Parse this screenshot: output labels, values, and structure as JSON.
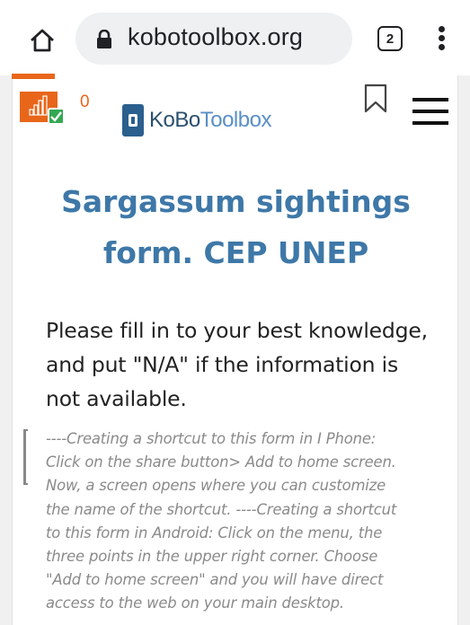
{
  "browser": {
    "url": "kobotoolbox.org",
    "tab_count": "2",
    "icons": [
      "home-icon",
      "lock-icon",
      "tab-switcher-icon",
      "more-vert-icon"
    ]
  },
  "header": {
    "queue_count": "0",
    "logo": {
      "kobo": "KoBo",
      "toolbox": "Toolbox"
    },
    "icons": [
      "offline-status-icon",
      "bookmark-icon",
      "hamburger-menu-icon"
    ]
  },
  "form": {
    "title_line1": "Sargassum sightings",
    "title_line2": "form. CEP UNEP",
    "intro_line1": "Please fill in to your best knowledge,",
    "intro_line2": "and put \"N/A\" if the information is",
    "intro_line3": "not available.",
    "hint_lines": [
      "----Creating a shortcut to this form in I Phone:",
      "Click on the share button> Add to home screen.",
      "Now, a screen opens where you can customize",
      "the name of the shortcut. ----Creating a shortcut",
      "to this form in Android: Click on the menu, the",
      "three points in the upper right corner. Choose",
      "\"Add to home screen\" and you will have direct",
      "access to the web on your main desktop."
    ]
  },
  "colors": {
    "accent_orange": "#e8661a",
    "title_blue": "#3e78a8",
    "logo_dark": "#2b4f6e",
    "logo_light": "#5a8fc7",
    "check_green": "#34a853"
  }
}
